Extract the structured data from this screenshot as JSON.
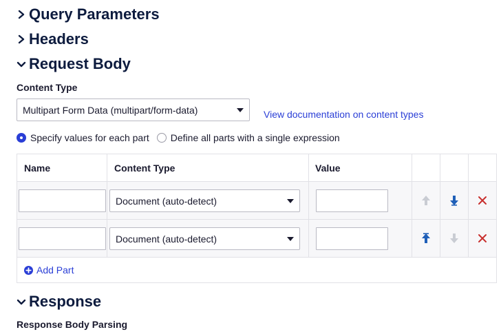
{
  "sections": {
    "query_parameters": "Query Parameters",
    "headers": "Headers",
    "request_body": "Request Body",
    "response": "Response"
  },
  "request_body": {
    "content_type_label": "Content Type",
    "content_type_value": "Multipart Form Data (multipart/form-data)",
    "doc_link": "View documentation on content types",
    "radio_specify": "Specify values for each part",
    "radio_single": "Define all parts with a single expression",
    "radio_selected": "specify"
  },
  "parts_table": {
    "headers": {
      "name": "Name",
      "content_type": "Content Type",
      "value": "Value"
    },
    "rows": [
      {
        "name": "",
        "content_type": "Document (auto-detect)",
        "value": ""
      },
      {
        "name": "",
        "content_type": "Document (auto-detect)",
        "value": ""
      }
    ],
    "add_part_label": "Add Part"
  },
  "response": {
    "body_parsing_label": "Response Body Parsing"
  },
  "colors": {
    "accent": "#2a3ed6",
    "move_active": "#1f5fb8",
    "move_disabled": "#c9ccd3",
    "delete": "#c8302e"
  }
}
